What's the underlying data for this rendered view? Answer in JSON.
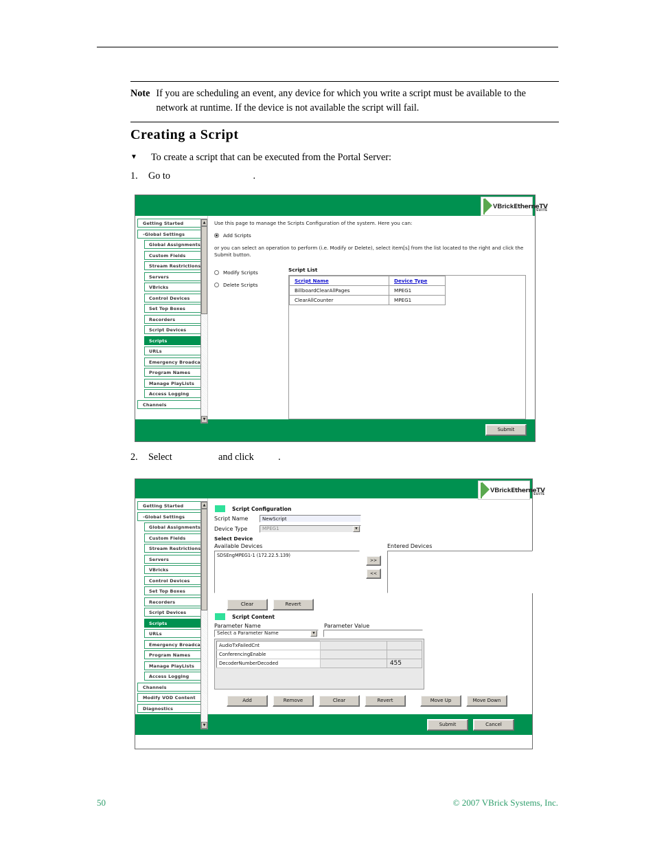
{
  "document": {
    "note": {
      "label": "Note",
      "text": "If you are scheduling an event, any device for which you write a script must be available to the network at runtime. If the device is not available the script will fail."
    },
    "heading": "Creating a Script",
    "intro_marker": "▼",
    "intro_text": "To create a script that can be executed from the Portal Server:",
    "steps": [
      {
        "num": "1.",
        "text": "Go to                                  ."
      },
      {
        "num": "2.",
        "text": "Select                   and click          ."
      }
    ],
    "footer": {
      "page_number": "50",
      "copyright": "© 2007 VBrick Systems, Inc."
    }
  },
  "logo": {
    "brand": "VBrick",
    "product": "EtherneTV",
    "suite": "SUITE"
  },
  "colors": {
    "brand_green": "#009150",
    "chip_green": "#2fe09a",
    "sidebar_border": "#2e9e6b",
    "link_blue": "#1515cf",
    "footer_text": "#2e9e6b"
  },
  "sidebar": {
    "items_shot1": [
      {
        "label": "Getting Started",
        "level": 1,
        "selected": false
      },
      {
        "label": "-Global Settings",
        "level": 1,
        "selected": false
      },
      {
        "label": "Global Assignments",
        "level": 2,
        "selected": false
      },
      {
        "label": "Custom Fields",
        "level": 2,
        "selected": false
      },
      {
        "label": "Stream Restrictions",
        "level": 2,
        "selected": false
      },
      {
        "label": "Servers",
        "level": 2,
        "selected": false
      },
      {
        "label": "VBricks",
        "level": 2,
        "selected": false
      },
      {
        "label": "Control Devices",
        "level": 2,
        "selected": false
      },
      {
        "label": "Set Top Boxes",
        "level": 2,
        "selected": false
      },
      {
        "label": "Recorders",
        "level": 2,
        "selected": false
      },
      {
        "label": "Script Devices",
        "level": 2,
        "selected": false
      },
      {
        "label": "Scripts",
        "level": 2,
        "selected": true
      },
      {
        "label": "URLs",
        "level": 2,
        "selected": false
      },
      {
        "label": "Emergency Broadcast",
        "level": 2,
        "selected": false
      },
      {
        "label": "Program Names",
        "level": 2,
        "selected": false
      },
      {
        "label": "Manage PlayLists",
        "level": 2,
        "selected": false
      },
      {
        "label": "Access Logging",
        "level": 2,
        "selected": false
      },
      {
        "label": "Channels",
        "level": 1,
        "selected": false
      }
    ],
    "items_shot2": [
      {
        "label": "Getting Started",
        "level": 1,
        "selected": false
      },
      {
        "label": "-Global Settings",
        "level": 1,
        "selected": false
      },
      {
        "label": "Global Assignments",
        "level": 2,
        "selected": false
      },
      {
        "label": "Custom Fields",
        "level": 2,
        "selected": false
      },
      {
        "label": "Stream Restrictions",
        "level": 2,
        "selected": false
      },
      {
        "label": "Servers",
        "level": 2,
        "selected": false
      },
      {
        "label": "VBricks",
        "level": 2,
        "selected": false
      },
      {
        "label": "Control Devices",
        "level": 2,
        "selected": false
      },
      {
        "label": "Set Top Boxes",
        "level": 2,
        "selected": false
      },
      {
        "label": "Recorders",
        "level": 2,
        "selected": false
      },
      {
        "label": "Script Devices",
        "level": 2,
        "selected": false
      },
      {
        "label": "Scripts",
        "level": 2,
        "selected": true
      },
      {
        "label": "URLs",
        "level": 2,
        "selected": false
      },
      {
        "label": "Emergency Broadcast",
        "level": 2,
        "selected": false
      },
      {
        "label": "Program Names",
        "level": 2,
        "selected": false
      },
      {
        "label": "Manage PlayLists",
        "level": 2,
        "selected": false
      },
      {
        "label": "Access Logging",
        "level": 2,
        "selected": false
      },
      {
        "label": "Channels",
        "level": 1,
        "selected": false
      },
      {
        "label": "Modify VOD Content",
        "level": 1,
        "selected": false
      },
      {
        "label": "Diagnostics",
        "level": 1,
        "selected": false
      }
    ],
    "scroll_up": "▲",
    "scroll_down": "▼"
  },
  "shot1": {
    "lead": "Use this page to manage the Scripts Configuration of the system. Here you can:",
    "radio_add": "Add Scripts",
    "paragraph": "or you can select an operation to perform (i.e. Modify or Delete), select item[s] from the list located to the right and click the Submit button.",
    "radio_modify": "Modify Scripts",
    "radio_delete": "Delete Scripts",
    "list_title": "Script List",
    "table": {
      "headers": [
        "Script Name",
        "Device Type"
      ],
      "rows": [
        [
          "BillboardClearAllPages",
          "MPEG1"
        ],
        [
          "ClearAllCounter",
          "MPEG1"
        ]
      ]
    },
    "submit_label": "Submit"
  },
  "shot2": {
    "section_config": "Script Configuration",
    "script_name_label": "Script Name",
    "script_name_value": "NewScript",
    "device_type_label": "Device Type",
    "device_type_value": "MPEG1",
    "select_device_label": "Select Device",
    "available_label": "Available Devices",
    "available_items": [
      "SDSEngMPEG1-1 (172.22.5.139)"
    ],
    "entered_label": "Entered Devices",
    "entered_items": [],
    "move_right": ">>",
    "move_left": "<<",
    "clear_label": "Clear",
    "revert_label": "Revert",
    "section_content": "Script Content",
    "param_name_label": "Parameter Name",
    "param_value_label": "Parameter Value",
    "param_name_select": "Select a Parameter Name",
    "param_value_input": "",
    "param_rows": [
      {
        "name": "AudioTxFailedCnt",
        "value": "",
        "num": ""
      },
      {
        "name": "ConferencingEnable",
        "value": "",
        "num": ""
      },
      {
        "name": "DecoderNumberDecoded",
        "value": "",
        "num": "455"
      }
    ],
    "buttons": [
      "Add",
      "Remove",
      "Clear",
      "Revert",
      "Move Up",
      "Move Down"
    ],
    "submit_label": "Submit",
    "cancel_label": "Cancel"
  }
}
